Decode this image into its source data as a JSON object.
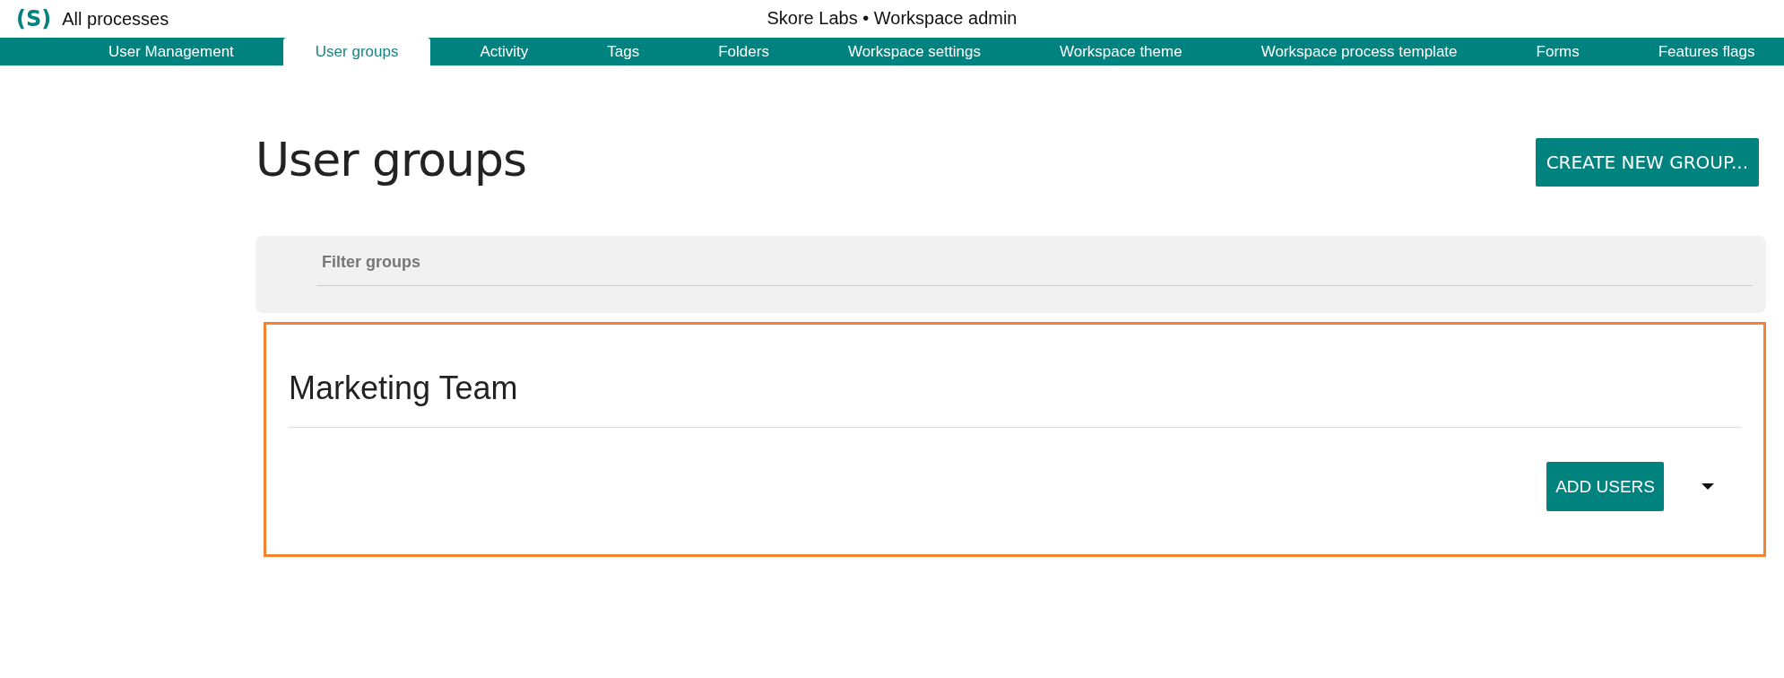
{
  "header": {
    "logo": "(S)",
    "link": "All processes",
    "title": "Skore Labs • Workspace admin"
  },
  "tabs": [
    {
      "label": "User Management",
      "selected": false
    },
    {
      "label": "User groups",
      "selected": true
    },
    {
      "label": "Activity",
      "selected": false
    },
    {
      "label": "Tags",
      "selected": false
    },
    {
      "label": "Folders",
      "selected": false
    },
    {
      "label": "Workspace settings",
      "selected": false
    },
    {
      "label": "Workspace theme",
      "selected": false
    },
    {
      "label": "Workspace process template",
      "selected": false
    },
    {
      "label": "Forms",
      "selected": false
    },
    {
      "label": "Features flags",
      "selected": false
    }
  ],
  "page": {
    "heading": "User groups",
    "create_button": "CREATE NEW GROUP...",
    "filter": {
      "placeholder": "Filter groups"
    }
  },
  "groups": [
    {
      "name": "Marketing Team",
      "highlighted": true,
      "add_button": "ADD USERS"
    }
  ]
}
